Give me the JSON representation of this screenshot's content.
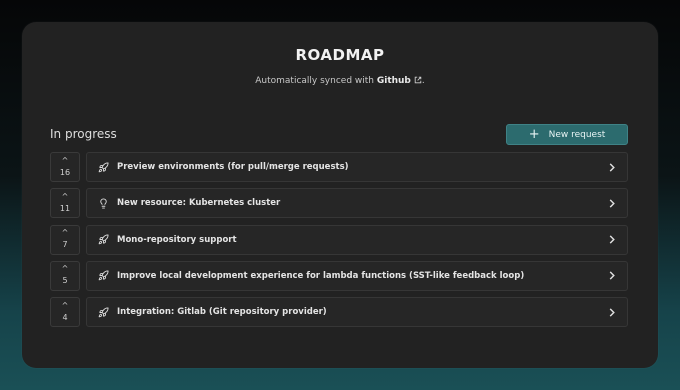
{
  "header": {
    "title": "ROADMAP",
    "subtitle_prefix": "Automatically synced with ",
    "subtitle_link": "Github",
    "subtitle_suffix": "."
  },
  "section": {
    "title": "In progress",
    "new_request_label": "New request"
  },
  "items": [
    {
      "votes": "16",
      "label": "Preview environments (for pull/merge requests)",
      "icon": "rocket-icon"
    },
    {
      "votes": "11",
      "label": "New resource: Kubernetes cluster",
      "icon": "lightbulb-icon"
    },
    {
      "votes": "7",
      "label": "Mono-repository support",
      "icon": "rocket-icon"
    },
    {
      "votes": "5",
      "label": "Improve local development experience for lambda functions (SST-like feedback loop)",
      "icon": "rocket-icon"
    },
    {
      "votes": "4",
      "label": "Integration: Gitlab (Git repository provider)",
      "icon": "rocket-icon"
    }
  ],
  "colors": {
    "card_background": "#222222",
    "accent_button": "#2c6b6e"
  }
}
